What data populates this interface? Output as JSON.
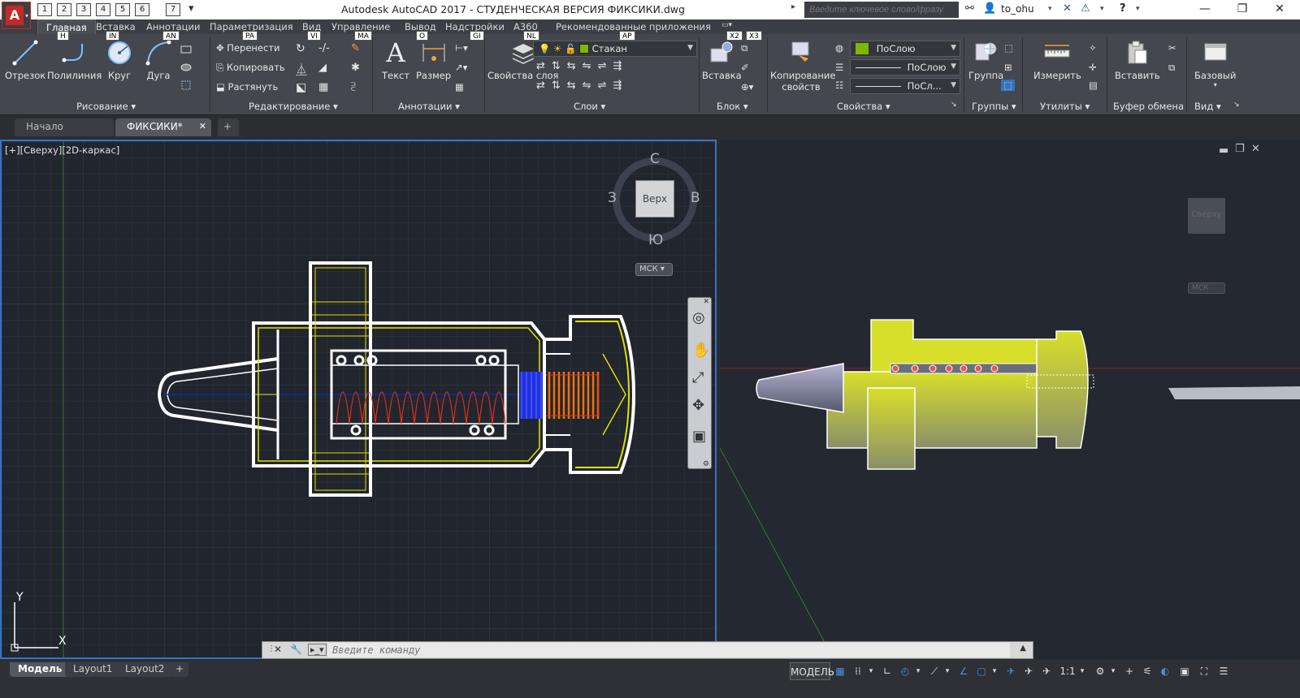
{
  "app": {
    "title": "Autodesk AutoCAD 2017 - СТУДЕНЧЕСКАЯ ВЕРСИЯ    ФИКСИКИ.dwg",
    "logo_letter": "A",
    "search_placeholder": "Введите ключевое слово/фразу",
    "user": "to_ohu",
    "qa_keytips": [
      "1",
      "2",
      "3",
      "4",
      "5",
      "6",
      "7"
    ],
    "minimize": "—",
    "maximize": "❐",
    "close": "✕"
  },
  "ribbon_tabs": [
    {
      "label": "Главная",
      "keytip": "H"
    },
    {
      "label": "Вставка",
      "keytip": "IN"
    },
    {
      "label": "Аннотации",
      "keytip": "AN"
    },
    {
      "label": "Параметризация",
      "keytip": "PA"
    },
    {
      "label": "Вид",
      "keytip": "VI"
    },
    {
      "label": "Управление",
      "keytip": "MA"
    },
    {
      "label": "Вывод",
      "keytip": "O"
    },
    {
      "label": "Надстройки",
      "keytip": "GI"
    },
    {
      "label": "A360",
      "keytip": "NL"
    },
    {
      "label": "Рекомендованные приложения",
      "keytip": "AP"
    }
  ],
  "ribbon_extra_keytips": [
    "X2",
    "X3"
  ],
  "panels": {
    "draw": {
      "title": "Рисование",
      "buttons": [
        "Отрезок",
        "Полилиния",
        "Круг",
        "Дуга"
      ]
    },
    "modify": {
      "title": "Редактирование",
      "items": [
        "Перенести",
        "Копировать",
        "Растянуть"
      ]
    },
    "annotation": {
      "title": "Аннотации",
      "buttons": [
        "Текст",
        "Размер"
      ]
    },
    "layers": {
      "title": "Слои",
      "button": "Свойства слоя",
      "current_layer": "Стакан",
      "layer_color": "#7fb800"
    },
    "block": {
      "title": "Блок",
      "button": "Вставка"
    },
    "properties": {
      "title": "Свойства",
      "button": "Копирование свойств",
      "color": "ПоСлою",
      "linetype": "ПоСлою",
      "lineweight": "ПоСл...",
      "color_swatch": "#7fb800"
    },
    "groups": {
      "title": "Группы",
      "button": "Группа"
    },
    "utilities": {
      "title": "Утилиты",
      "button": "Измерить"
    },
    "clipboard": {
      "title": "Буфер обмена",
      "button": "Вставить"
    },
    "view": {
      "title": "Вид",
      "button": "Базовый"
    }
  },
  "doc_tabs": {
    "start": "Начало",
    "file": "ФИКСИКИ*",
    "add": "+"
  },
  "viewport_left": {
    "label": "[+][Сверху][2D-каркас]",
    "viewcube": {
      "north": "С",
      "south": "Ю",
      "west": "З",
      "east": "В",
      "face": "Верх",
      "ucs": "МСК"
    },
    "ucs_y": "Y",
    "ucs_x": "X"
  },
  "viewport_right": {
    "cube_face": "Сверху",
    "ucs": "МСК"
  },
  "command_line": {
    "placeholder": "Введите команду"
  },
  "layout_tabs": [
    "Модель",
    "Layout1",
    "Layout2"
  ],
  "status": {
    "model_label": "МОДЕЛЬ",
    "scale": "1:1"
  },
  "colors": {
    "accent": "#3573c2",
    "drawing_yellow": "#dfe000",
    "drawing_white": "#ffffff",
    "spring_red": "#e03020",
    "spring_blue": "#2030e0"
  }
}
